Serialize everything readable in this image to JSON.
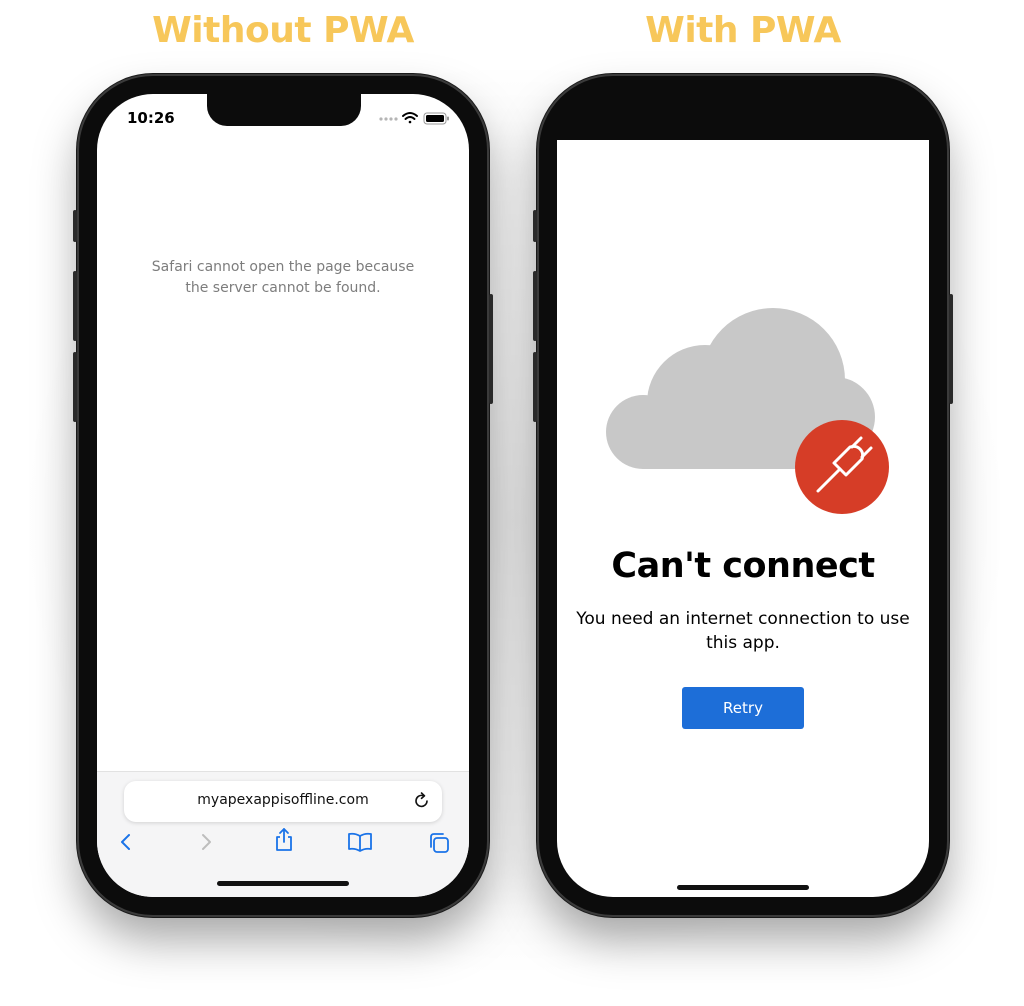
{
  "headings": {
    "left": "Without PWA",
    "right": "With PWA"
  },
  "colors": {
    "heading": "#f7c75a",
    "retry_button": "#1d6ed8",
    "plug_badge": "#d63d27",
    "cloud": "#c8c8c8",
    "safari_blue": "#1a73e8"
  },
  "left_phone": {
    "status_bar": {
      "time": "10:26",
      "icons": [
        "signal-dots-icon",
        "wifi-icon",
        "battery-icon"
      ]
    },
    "error_message": {
      "line1": "Safari cannot open the page because",
      "line2": "the server cannot be found."
    },
    "url_bar": {
      "url": "myapexappisoffline.com",
      "reload_icon": "reload-icon"
    },
    "toolbar_icons": [
      "back-icon",
      "forward-icon",
      "share-icon",
      "bookmarks-icon",
      "tabs-icon"
    ]
  },
  "right_phone": {
    "illustration": {
      "cloud_icon": "cloud-icon",
      "plug_icon": "unplugged-icon"
    },
    "title": "Can't connect",
    "message": {
      "line1": "You need an internet connection to use",
      "line2": "this app."
    },
    "retry_label": "Retry"
  }
}
